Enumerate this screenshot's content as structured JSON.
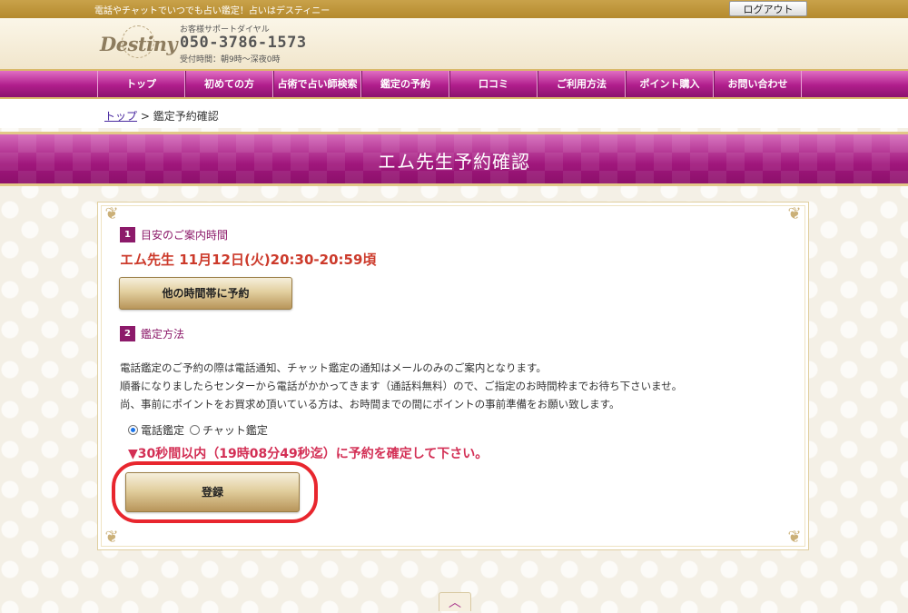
{
  "topbar": {
    "tagline": "電話やチャットでいつでも占い鑑定！占いはデスティニー",
    "logout_label": "ログアウト"
  },
  "header": {
    "logo_text": "Destiny",
    "support_label": "お客様サポートダイヤル",
    "phone": "050-3786-1573",
    "hours": "受付時間：朝9時～深夜0時"
  },
  "nav": {
    "items": [
      {
        "label": "トップ"
      },
      {
        "label": "初めての方"
      },
      {
        "label": "占術で占い師検索"
      },
      {
        "label": "鑑定の予約"
      },
      {
        "label": "口コミ"
      },
      {
        "label": "ご利用方法"
      },
      {
        "label": "ポイント購入"
      },
      {
        "label": "お問い合わせ"
      }
    ]
  },
  "breadcrumb": {
    "home_label": "トップ",
    "separator": " > ",
    "current": "鑑定予約確認"
  },
  "page": {
    "title": "エム先生予約確認"
  },
  "step1": {
    "number": "1",
    "title": "目安のご案内時間",
    "appointment": "エム先生 11月12日(火)20:30-20:59頃",
    "other_time_button": "他の時間帯に予約"
  },
  "step2": {
    "number": "2",
    "title": "鑑定方法",
    "desc_lines": [
      "電話鑑定のご予約の際は電話通知、チャット鑑定の通知はメールのみのご案内となります。",
      "順番になりましたらセンターから電話がかかってきます（通話料無料）ので、ご指定のお時間枠までお待ち下さいませ。",
      "尚、事前にポイントをお買求め頂いている方は、お時間までの間にポイントの事前準備をお願い致します。"
    ],
    "options": [
      {
        "label": "電話鑑定",
        "checked": true
      },
      {
        "label": "チャット鑑定",
        "checked": false
      }
    ],
    "deadline": "▼30秒間以内（19時08分49秒迄）に予約を確定して下さい。",
    "register_button": "登録"
  },
  "back_to_top": "︿",
  "colors": {
    "accent_magenta": "#b3258d",
    "gold": "#c9a24a",
    "appointment_red": "#cc3a2b",
    "deadline_red": "#d32f55",
    "highlight_ring": "#e8262e"
  }
}
